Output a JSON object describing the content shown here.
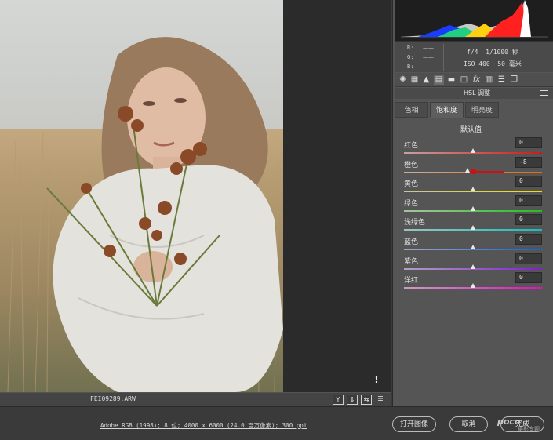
{
  "preview": {
    "filename": "FEI09289.ARW",
    "warning_icon": "warning-icon"
  },
  "view_buttons": [
    "Y",
    "⇕",
    "⇆",
    "☰"
  ],
  "info": {
    "r_label": "R:",
    "g_label": "G:",
    "b_label": "B:",
    "r_value": "——",
    "g_value": "——",
    "b_value": "——",
    "exposure": "f/4  1/1000 秒",
    "iso_lens": "ISO 400  50 毫米"
  },
  "toolbar_icons": [
    "aperture-icon",
    "grid-icon",
    "mountain-icon",
    "hsl-icon",
    "split-icon",
    "lens-icon",
    "fx-icon",
    "calibrate-icon",
    "presets-icon",
    "snapshot-icon"
  ],
  "panel": {
    "title": "HSL 调整",
    "tabs": [
      {
        "label": "色相",
        "active": false
      },
      {
        "label": "饱和度",
        "active": true
      },
      {
        "label": "明亮度",
        "active": false
      }
    ],
    "default_link": "默认值",
    "sliders": [
      {
        "label": "红色",
        "value": "0",
        "pos": 0.5,
        "colors": [
          "#c8a0a0",
          "#d01818"
        ]
      },
      {
        "label": "橙色",
        "value": "-8",
        "pos": 0.46,
        "colors": [
          "#c8b09a",
          "#e06a10"
        ]
      },
      {
        "label": "黄色",
        "value": "0",
        "pos": 0.5,
        "colors": [
          "#c8c4a0",
          "#f0e010"
        ]
      },
      {
        "label": "绿色",
        "value": "0",
        "pos": 0.5,
        "colors": [
          "#a8c4a0",
          "#20c020"
        ]
      },
      {
        "label": "浅绿色",
        "value": "0",
        "pos": 0.5,
        "colors": [
          "#a0c4c0",
          "#10c0c0"
        ]
      },
      {
        "label": "蓝色",
        "value": "0",
        "pos": 0.5,
        "colors": [
          "#a0a8c8",
          "#1060e0"
        ]
      },
      {
        "label": "紫色",
        "value": "0",
        "pos": 0.5,
        "colors": [
          "#b0a0c8",
          "#8020d0"
        ]
      },
      {
        "label": "洋红",
        "value": "0",
        "pos": 0.5,
        "colors": [
          "#c8a0c0",
          "#e010c0"
        ]
      }
    ]
  },
  "footer": {
    "info": "Adobe RGB (1998); 8 位; 4000 x 6000 (24.0 百万像素); 300 ppi",
    "open_button": "打开图像",
    "cancel_button": "取消",
    "done_button": "完成",
    "watermark": "poco",
    "watermark_sub": "摄影专题"
  }
}
